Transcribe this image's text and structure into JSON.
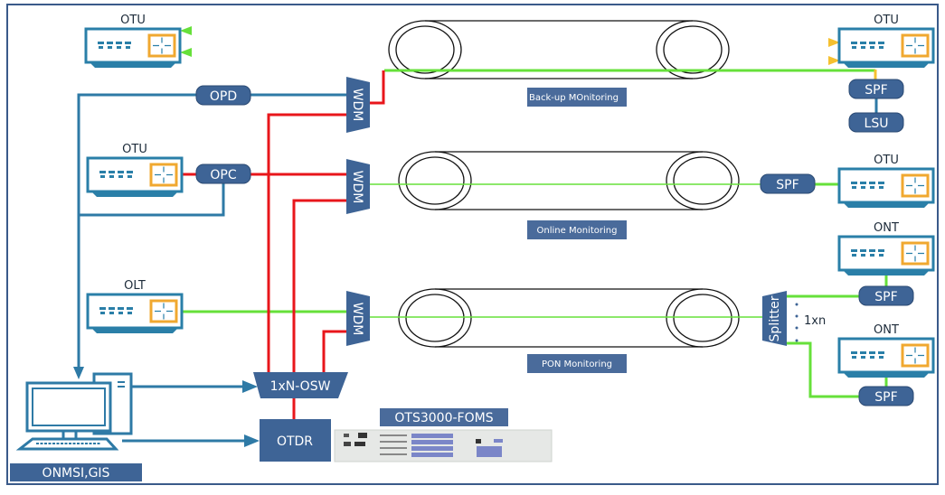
{
  "colors": {
    "frame": "#3a5a8a",
    "box_blue": "#3e6496",
    "device_stroke": "#2a7fa8",
    "device_accent": "#f0a830",
    "control_line": "#2e7aa6",
    "otdr_line": "#e8161b",
    "fiber_green": "#66e03a",
    "fiber_yellow": "#f5d630"
  },
  "devices": {
    "otu_top_left": "OTU",
    "otu_top_right": "OTU",
    "otu_mid_left": "OTU",
    "otu_mid_right": "OTU",
    "olt": "OLT",
    "ont_upper": "ONT",
    "ont_lower": "ONT"
  },
  "modules": {
    "opd": "OPD",
    "opc": "OPC",
    "wdm_top": "WDM",
    "wdm_mid": "WDM",
    "wdm_bottom": "WDM",
    "spf_top": "SPF",
    "lsu": "LSU",
    "spf_mid": "SPF",
    "spf_ont_upper": "SPF",
    "spf_ont_lower": "SPF",
    "splitter": "Splitter",
    "splitter_ratio": "1xn",
    "osw": "1xN-OSW",
    "otdr": "OTDR",
    "product": "OTS3000-FOMS",
    "nms": "ONMSI,GIS"
  },
  "links": {
    "backup": "Back-up MOnitoring",
    "online": "Online Monitoring",
    "pon": "PON Monitoring"
  },
  "icons": {
    "device": "network-switch-icon",
    "computer": "desktop-computer-icon",
    "rack": "rack-equipment-icon"
  }
}
